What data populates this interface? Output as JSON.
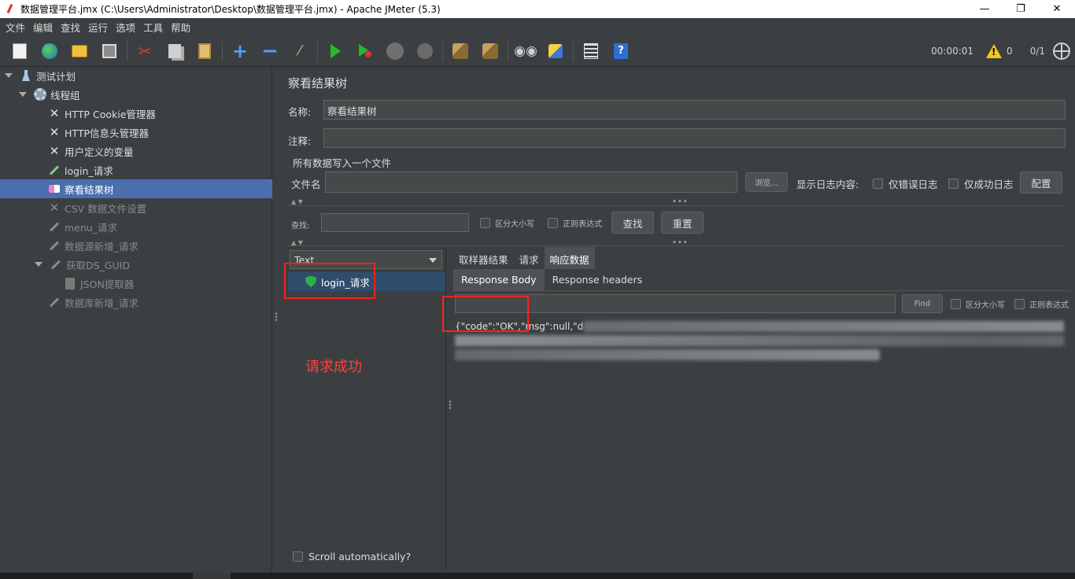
{
  "window": {
    "title": "数据管理平台.jmx (C:\\Users\\Administrator\\Desktop\\数据管理平台.jmx) - Apache JMeter (5.3)",
    "minimize": "—",
    "maximize": "❐",
    "close": "✕"
  },
  "menu": [
    "文件",
    "编辑",
    "查找",
    "运行",
    "选项",
    "工具",
    "帮助"
  ],
  "toolbar": {
    "icons": [
      "new-icon",
      "templates-icon",
      "open-icon",
      "save-icon",
      "cut-icon",
      "copy-icon",
      "paste-icon",
      "expand-icon",
      "collapse-icon",
      "toggle-icon",
      "start-icon",
      "start-no-pauses-icon",
      "stop-icon",
      "shutdown-icon",
      "clear-icon",
      "clear-all-icon",
      "search-icon",
      "reset-search-icon",
      "function-helper-icon",
      "help-icon"
    ],
    "elapsed": "00:00:01",
    "warnings": "0",
    "threads": "0/1"
  },
  "tree": {
    "items": [
      {
        "label": "测试计划",
        "icon": "flask-icon"
      },
      {
        "label": "线程组",
        "icon": "gear-icon"
      },
      {
        "label": "HTTP Cookie管理器",
        "icon": "tools-icon"
      },
      {
        "label": "HTTP信息头管理器",
        "icon": "tools-icon"
      },
      {
        "label": "用户定义的变量",
        "icon": "tools-icon"
      },
      {
        "label": "login_请求",
        "icon": "pen-icon"
      },
      {
        "label": "察看结果树",
        "icon": "chart-icon"
      },
      {
        "label": "CSV 数据文件设置",
        "icon": "tools-icon"
      },
      {
        "label": "menu_请求",
        "icon": "pen-icon"
      },
      {
        "label": "数据源新增_请求",
        "icon": "pen-icon"
      },
      {
        "label": "获取DS_GUID",
        "icon": "pen-icon"
      },
      {
        "label": "JSON提取器",
        "icon": "doc-icon"
      },
      {
        "label": "数据库新增_请求",
        "icon": "pen-icon"
      }
    ]
  },
  "panel": {
    "title": "察看结果树",
    "name_label": "名称:",
    "name_value": "察看结果树",
    "comment_label": "注释:",
    "comment_value": "",
    "group_title": "所有数据写入一个文件",
    "filename_label": "文件名",
    "browse": "浏览...",
    "log_label": "显示日志内容:",
    "errors_only": "仅错误日志",
    "success_only": "仅成功日志",
    "configure": "配置",
    "search_label": "查找:",
    "case_sensitive": "区分大小写",
    "regex": "正则表达式",
    "search_btn": "查找",
    "reset_btn": "重置"
  },
  "results": {
    "renderer": "Text",
    "items": [
      {
        "label": "login_请求",
        "status": "success"
      }
    ],
    "scroll_auto": "Scroll automatically?",
    "annotation": "请求成功",
    "tabs": [
      "取样器结果",
      "请求",
      "响应数据"
    ],
    "active_tab": "响应数据",
    "subtabs": [
      "Response Body",
      "Response headers"
    ],
    "find_btn": "Find",
    "case_sensitive": "区分大小写",
    "regex": "正则表达式",
    "body_prefix": "{\"code\":\"OK\",\"msg\":null,\"d"
  },
  "colors": {
    "background": "#3c3f41",
    "selection": "#4b6eaf",
    "annotation": "#ff4040",
    "success": "#2fae4a"
  }
}
